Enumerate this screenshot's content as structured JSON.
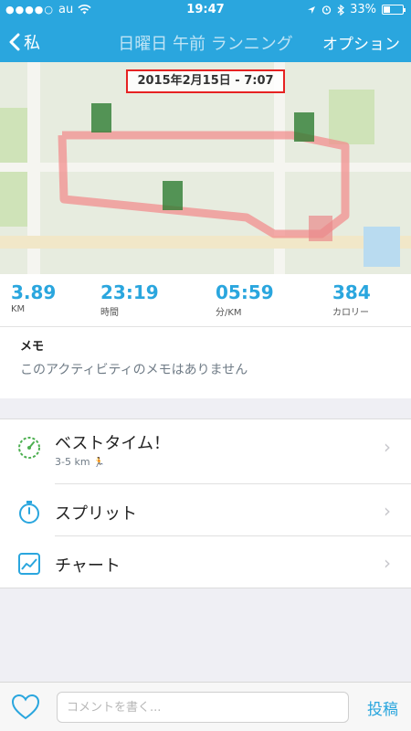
{
  "status": {
    "dots": "●●●●○",
    "carrier": "au",
    "time": "19:47",
    "battery": "33%",
    "battery_level": 0.33
  },
  "nav": {
    "back_label": "私",
    "title": "日曜日 午前 ランニング",
    "option_label": "オプション"
  },
  "map": {
    "date_label": "2015年2月15日 - 7:07"
  },
  "stats": [
    {
      "value": "3.89",
      "label": "KM"
    },
    {
      "value": "23:19",
      "label": "時間"
    },
    {
      "value": "05:59",
      "label": "分/KM"
    },
    {
      "value": "384",
      "label": "カロリー"
    }
  ],
  "memo": {
    "heading": "メモ",
    "text": "このアクティビティのメモはありません"
  },
  "list": {
    "best_time": {
      "label": "ベストタイム！",
      "sub": "3-5 km",
      "icon": "speedometer-icon"
    },
    "splits": {
      "label": "スプリット",
      "icon": "stopwatch-icon"
    },
    "chart": {
      "label": "チャート",
      "icon": "chart-icon"
    }
  },
  "bottom": {
    "comment_placeholder": "コメントを書く...",
    "post_label": "投稿"
  },
  "colors": {
    "accent": "#2aa6de",
    "route": "#f28f8f",
    "marker": "#2e7d32",
    "highlight": "#e62222"
  }
}
